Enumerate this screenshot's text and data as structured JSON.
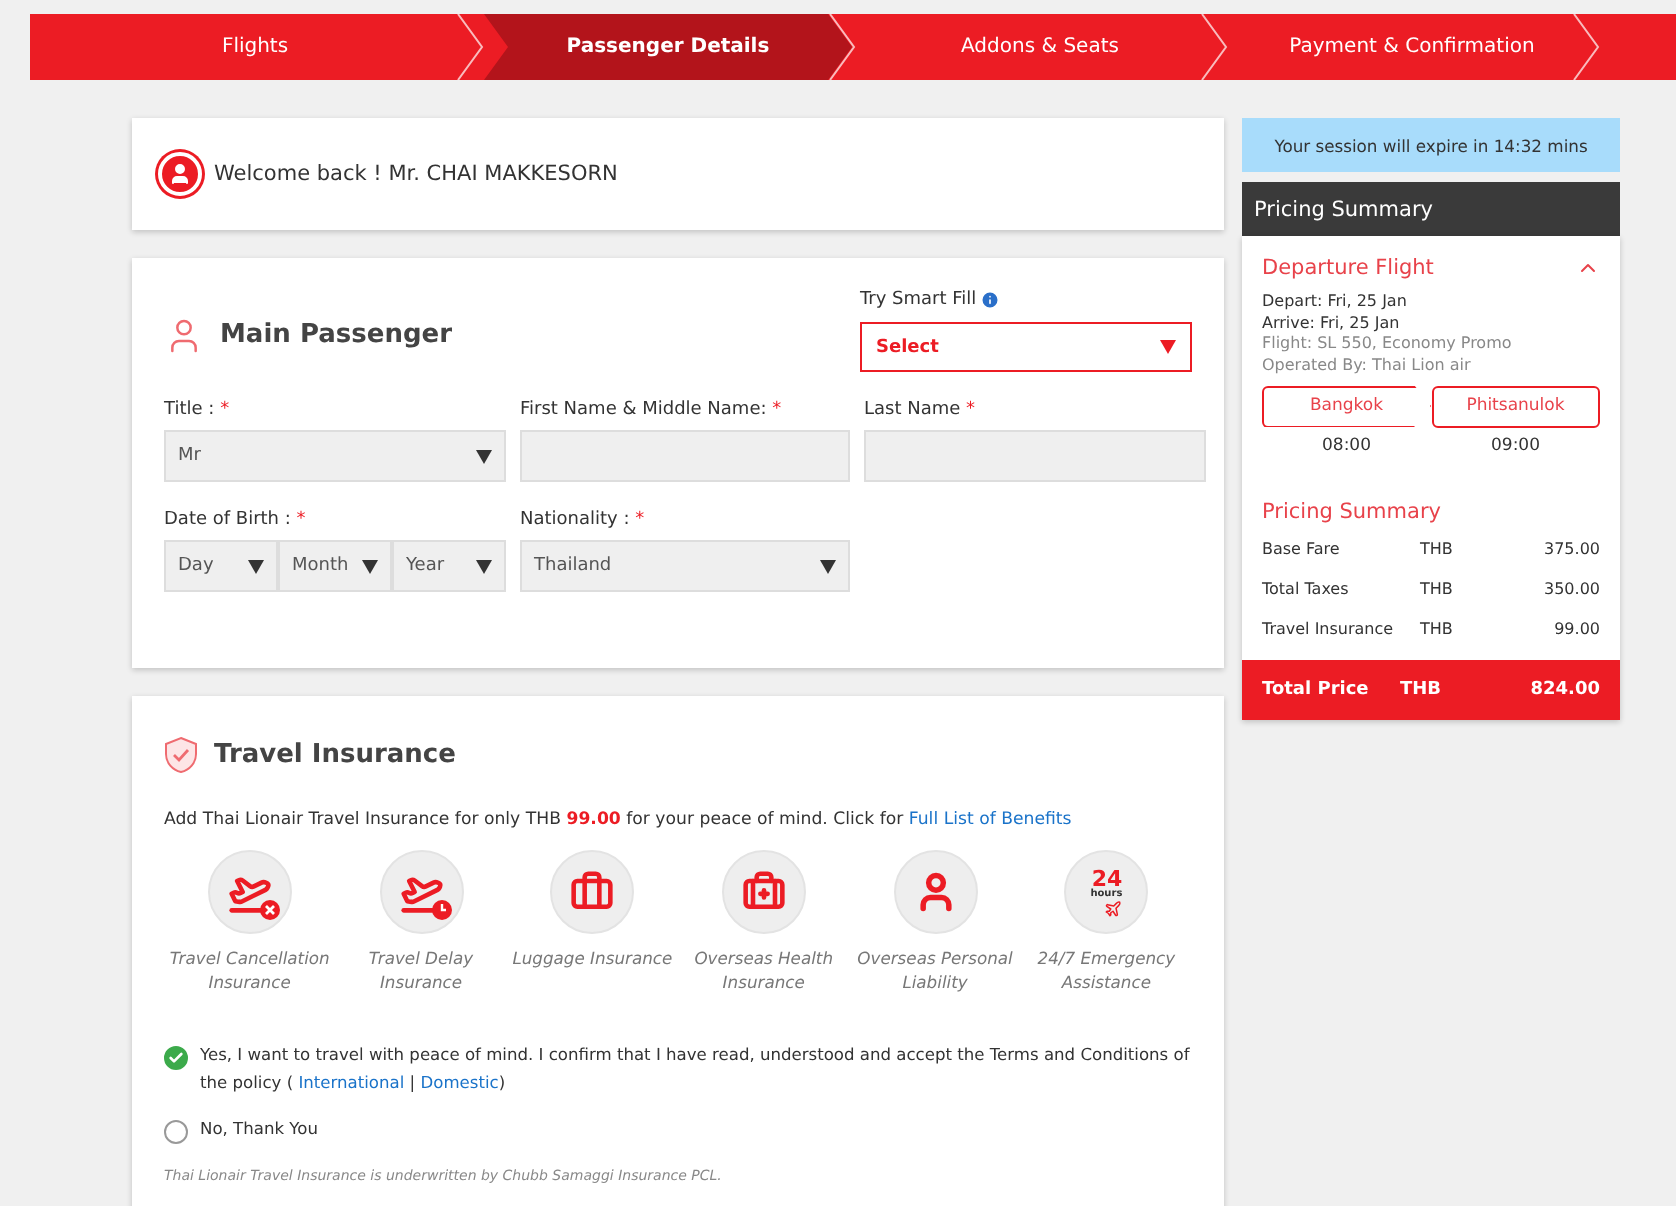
{
  "steps": [
    {
      "label": "Flights",
      "selected": false
    },
    {
      "label": "Passenger Details",
      "selected": true
    },
    {
      "label": "Addons & Seats",
      "selected": false
    },
    {
      "label": "Payment & Confirmation",
      "selected": false
    }
  ],
  "welcome": "Welcome back ! Mr. CHAI MAKKESORN",
  "main_passenger": {
    "title": "Main Passenger",
    "smart_fill_label": "Try Smart Fill",
    "smart_fill_value": "Select",
    "fields": [
      {
        "label": "Title :",
        "kind": "select",
        "value": "Mr"
      },
      {
        "label": "First Name & Middle Name:",
        "kind": "input"
      },
      {
        "label": "Last Name",
        "kind": "input"
      },
      {
        "label": "Date of Birth :",
        "kind": "date",
        "parts": [
          "Day",
          "Month",
          "Year"
        ]
      },
      {
        "label": "Nationality :",
        "kind": "select",
        "value": "Thailand"
      }
    ],
    "required_mark": "*"
  },
  "insurance": {
    "title": "Travel Insurance",
    "intro": "Add Thai Lionair Travel Insurance for only THB **99.00** for your peace of mind. Click for ",
    "intro_link": "Full List of Benefits",
    "benefits": [
      {
        "kind": "cancel",
        "label": "Travel Cancellation Insurance"
      },
      {
        "kind": "delay",
        "label": "Travel Delay Insurance"
      },
      {
        "kind": "luggage",
        "label": "Luggage Insurance"
      },
      {
        "kind": "health",
        "label": "Overseas Health Insurance"
      },
      {
        "kind": "liability",
        "label": "Overseas Personal Liability"
      },
      {
        "kind": "emergency",
        "label": "24/7 Emergency Assistance",
        "badge": "24",
        "badge_sub": "hours"
      }
    ],
    "options": [
      {
        "selected": true,
        "parts": [
          {
            "kind": "text",
            "text": "Yes, I want to travel with peace of mind. I confirm that I have read, understood and accept the Terms and Conditions of the policy ( "
          },
          {
            "kind": "link",
            "text": "International"
          },
          {
            "kind": "text",
            "text": " | "
          },
          {
            "kind": "link",
            "text": "Domestic"
          },
          {
            "kind": "text",
            "text": ")"
          }
        ]
      },
      {
        "selected": false,
        "parts": [
          {
            "kind": "text",
            "text": "No, Thank You"
          }
        ]
      }
    ],
    "footnote": "Thai Lionair Travel Insurance is underwritten by Chubb Samaggi Insurance PCL."
  },
  "session": "Your session will expire in 14:32 mins",
  "pricing": {
    "header": "Pricing Summary",
    "flight_title": "Departure Flight",
    "expanded": true,
    "details": [
      {
        "text": "Depart: Fri, 25 Jan",
        "muted": false
      },
      {
        "text": "Arrive: Fri, 25 Jan",
        "muted": false
      },
      {
        "text": "Flight: SL 550, Economy Promo",
        "muted": true
      },
      {
        "text": "Operated By: Thai Lion air",
        "muted": true
      }
    ],
    "route": [
      {
        "city": "Bangkok",
        "time": "08:00"
      },
      {
        "city": "Phitsanulok",
        "time": "09:00"
      }
    ],
    "summary_title": "Pricing Summary",
    "rows": [
      {
        "label": "Base Fare",
        "currency": "THB",
        "amount": "375.00"
      },
      {
        "label": "Total Taxes",
        "currency": "THB",
        "amount": "350.00"
      },
      {
        "label": "Travel Insurance",
        "currency": "THB",
        "amount": "99.00"
      }
    ],
    "total": {
      "label": "Total Price",
      "currency": "THB",
      "amount": "824.00"
    }
  }
}
